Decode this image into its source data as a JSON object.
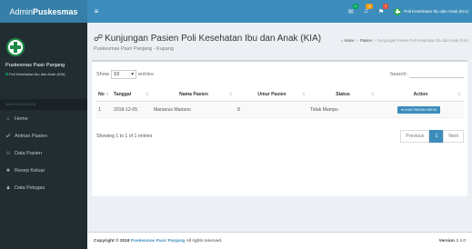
{
  "header": {
    "logo_regular": "Admin",
    "logo_bold": "Puskesmas",
    "toggle": "≡",
    "mail_badge": "4",
    "notif_badge": "10",
    "flag_badge": "9",
    "user_name": "Poli Kesehatan Ibu dan Anak (KIA)"
  },
  "sidebar": {
    "panel_name": "Puskesmas Pasir Panjang",
    "panel_sub": "Poli Kesehatan Ibu dan Anak (KIA)",
    "nav_header": "MAIN NAVIGATION",
    "items": [
      {
        "icon": "⌂",
        "label": "Home"
      },
      {
        "icon": "☍",
        "label": "Antrian Pasien"
      },
      {
        "icon": "⚇",
        "label": "Data Pasien"
      },
      {
        "icon": "✚",
        "label": "Resep Keluar"
      },
      {
        "icon": "♟",
        "label": "Data Petugas"
      }
    ]
  },
  "page": {
    "title_icon": "☍",
    "title": "Kunjungan Pasien Poli Kesehatan Ibu dan Anak (KIA)",
    "subtitle": "Puskesmas Pasir Panjang - Kupang",
    "breadcrumb": [
      "Home",
      "Pasien",
      "Kunjungan Pasien Poli Kesehatan Ibu dan Anak (KIA)"
    ]
  },
  "table": {
    "show_label": "Show",
    "show_value": "10",
    "entries_label": "entries",
    "search_label": "Search:",
    "columns": [
      "No",
      "Tanggal",
      "Nama Pasien",
      "Umur Pasien",
      "Status",
      "Action"
    ],
    "rows": [
      {
        "no": "1",
        "tanggal": "2018-12-05",
        "nama": "Marianus Mariano",
        "umur": "8",
        "status": "Tidak Mampu",
        "action": "♥ LIHAT REKAM MEDIS"
      }
    ],
    "info": "Showing 1 to 1 of 1 entries",
    "pagination": {
      "previous": "Previous",
      "current": "1",
      "next": "Next"
    }
  },
  "footer": {
    "copyright": "Copyright © 2018",
    "brand": "Puskesmas Pasir Panjang",
    "rights": "All rights reserved.",
    "version_label": "Version",
    "version_value": "2.4.0"
  }
}
